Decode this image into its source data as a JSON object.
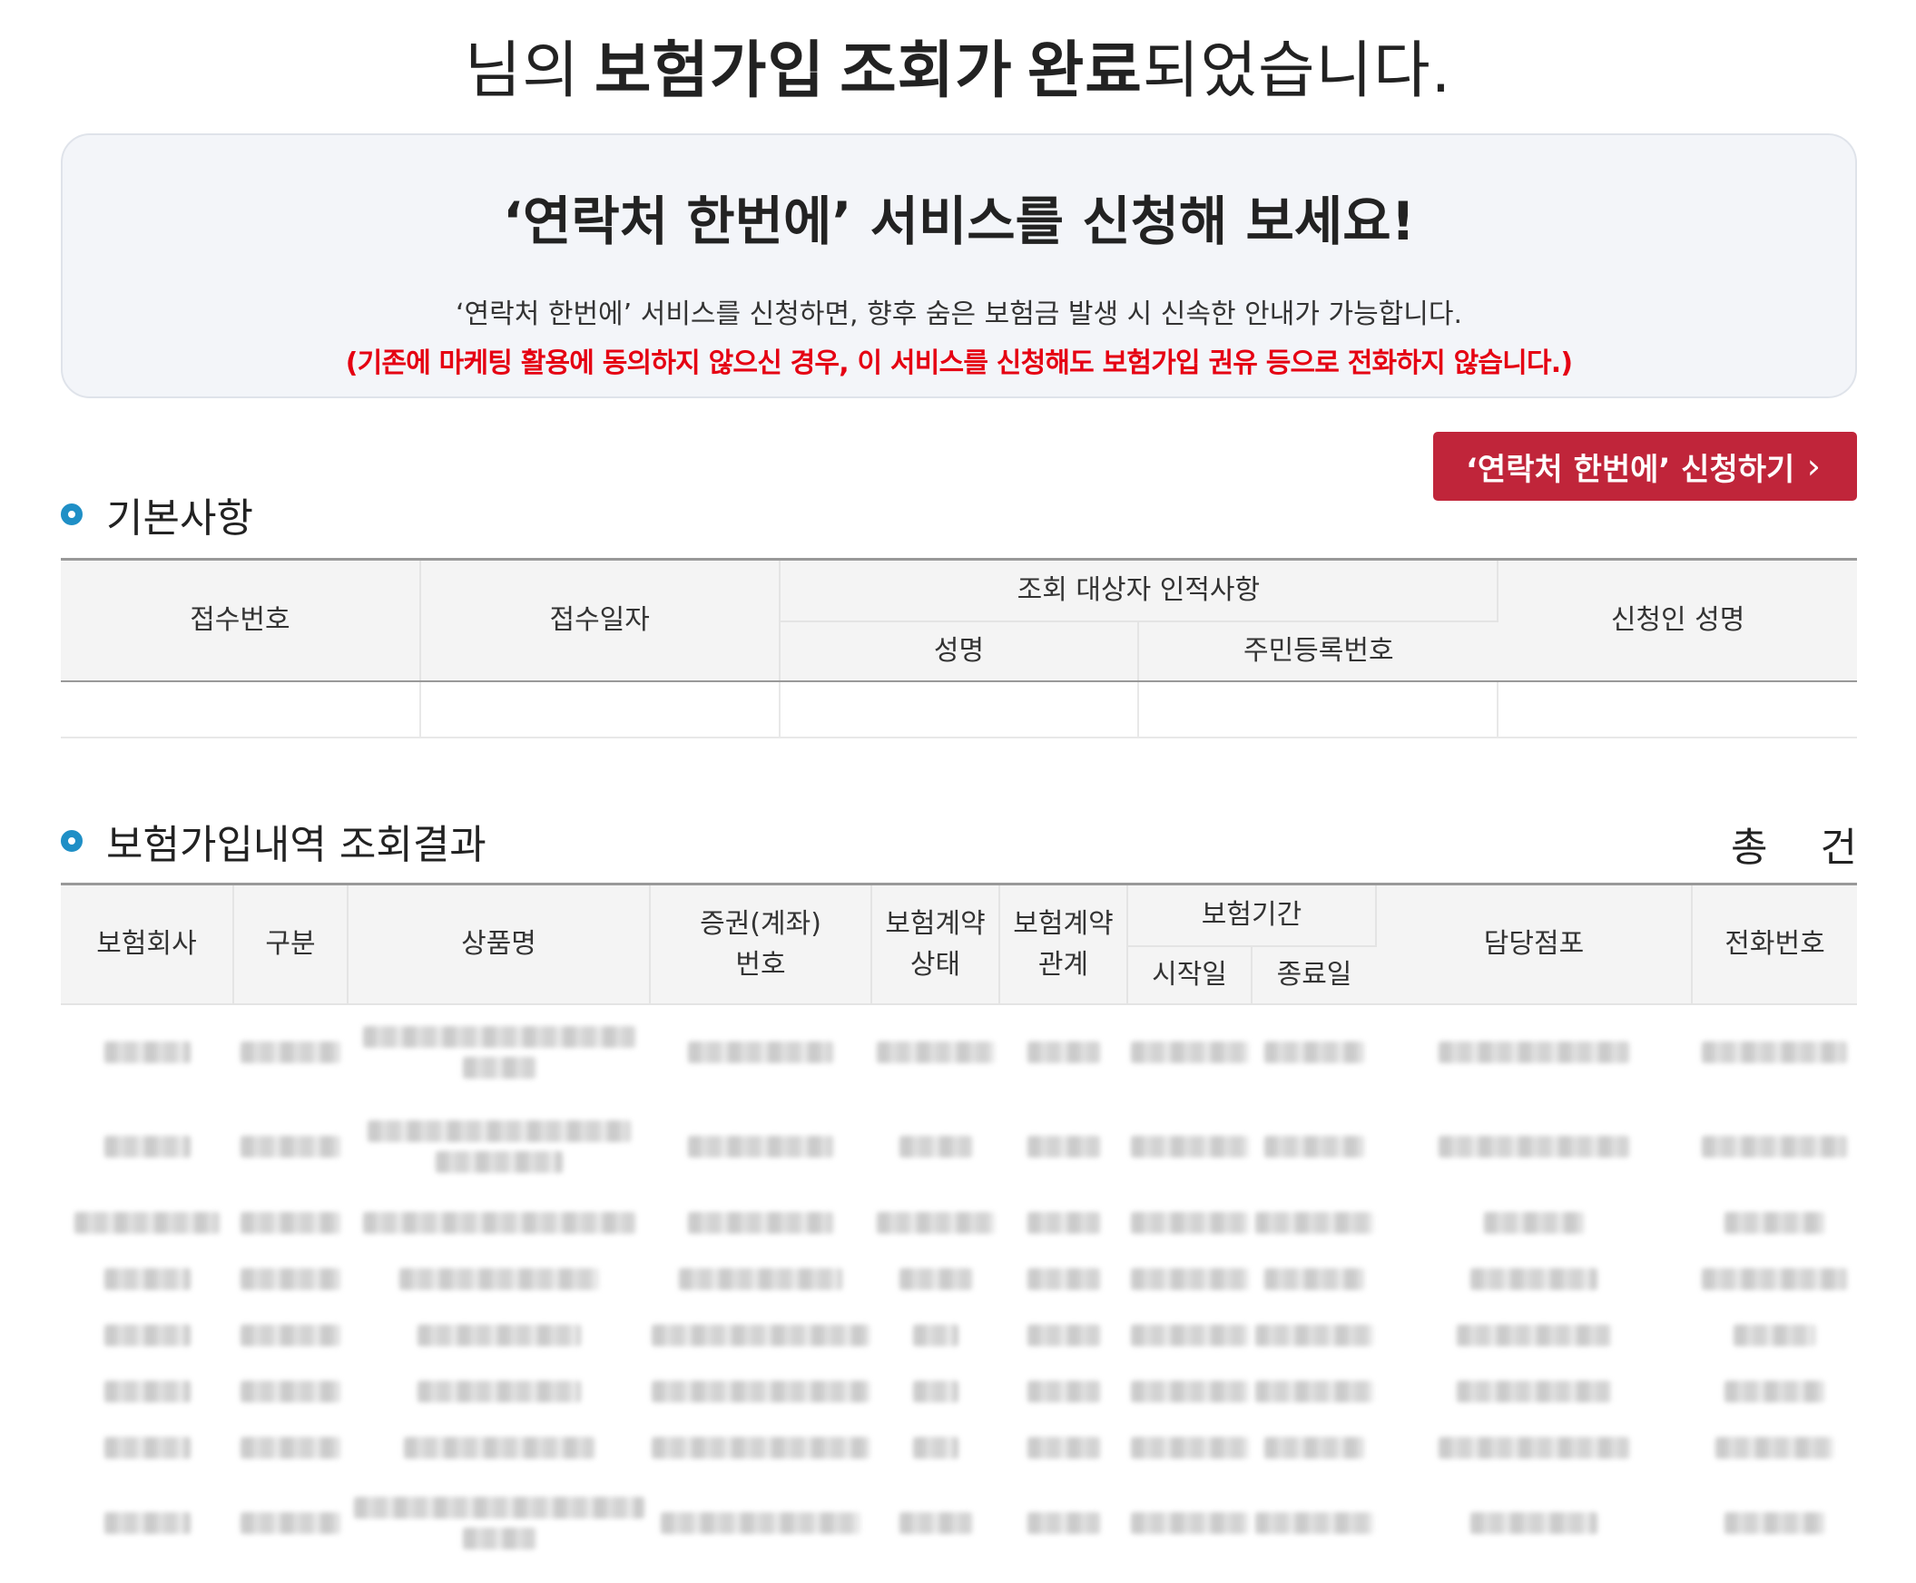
{
  "heading": {
    "part1": "님의",
    "part2": "보험가입",
    "part3": "조회가",
    "part4": "완료",
    "part5": "되었습니다."
  },
  "promo": {
    "title": "‘연락처 한번에’ 서비스를 신청해 보세요!",
    "description": "‘연락처 한번에’ 서비스를 신청하면, 향후 숨은 보험금 발생 시 신속한 안내가 가능합니다.",
    "notice": "(기존에 마케팅 활용에 동의하지 않으신 경우, 이 서비스를 신청해도 보험가입 권유 등으로 전화하지 않습니다.)"
  },
  "apply_button": {
    "label": "‘연락처 한번에’ 신청하기",
    "icon": "chevron-right-icon"
  },
  "basic_section": {
    "title": "기본사항",
    "headers": {
      "receipt_no": "접수번호",
      "receipt_date": "접수일자",
      "subject_group": "조회 대상자 인적사항",
      "name": "성명",
      "resident_no": "주민등록번호",
      "applicant_name": "신청인 성명"
    },
    "row": [
      "",
      "",
      "",
      "",
      ""
    ]
  },
  "results_section": {
    "title": "보험가입내역 조회결과",
    "total_label": "총",
    "count_label": "건",
    "headers": {
      "company": "보험회사",
      "category": "구분",
      "product": "상품명",
      "policy_no_1": "증권(계좌)",
      "policy_no_2": "번호",
      "status_1": "보험계약",
      "status_2": "상태",
      "relation_1": "보험계약",
      "relation_2": "관계",
      "period": "보험기간",
      "start": "시작일",
      "end": "종료일",
      "branch": "담당점포",
      "phone": "전화번호"
    },
    "row_count": 8
  },
  "colors": {
    "accent_button": "#c0253a",
    "notice_red": "#e50012",
    "ring_blue": "#1f8fc6"
  }
}
